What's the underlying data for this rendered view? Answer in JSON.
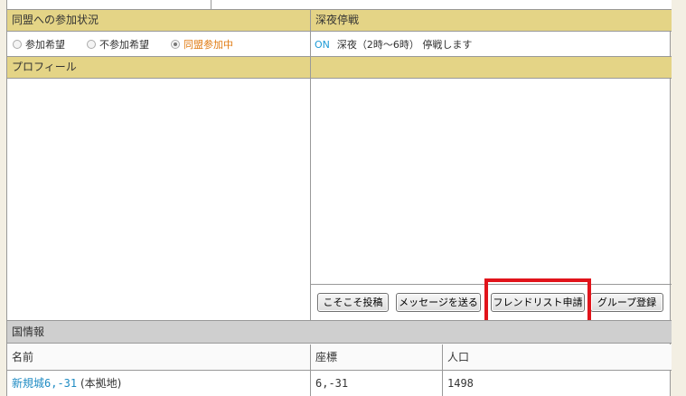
{
  "alliance": {
    "header": "同盟への参加状況",
    "options": [
      {
        "label": "参加希望",
        "checked": false
      },
      {
        "label": "不参加希望",
        "checked": false
      },
      {
        "label": "同盟参加中",
        "checked": true
      }
    ]
  },
  "night": {
    "header": "深夜停戦",
    "status": "ON",
    "text": "深夜（2時〜6時） 停戦します"
  },
  "profile": {
    "header": "プロフィール"
  },
  "buttons": {
    "secret_post": "こそこそ投稿",
    "send_message": "メッセージを送る",
    "friend_request": "フレンドリスト申請",
    "group_register": "グループ登録"
  },
  "country": {
    "header": "国情報",
    "columns": [
      "名前",
      "座標",
      "人口"
    ],
    "rows": [
      {
        "name": "新規城6,-31",
        "suffix": "(本拠地)",
        "coords": "6,-31",
        "population": "1498"
      }
    ]
  },
  "colors": {
    "header_bg": "#e4d486",
    "section_bg": "#cfcfcf",
    "highlight": "#e1141b",
    "link": "#1e8bc3",
    "active": "#e07b12"
  }
}
